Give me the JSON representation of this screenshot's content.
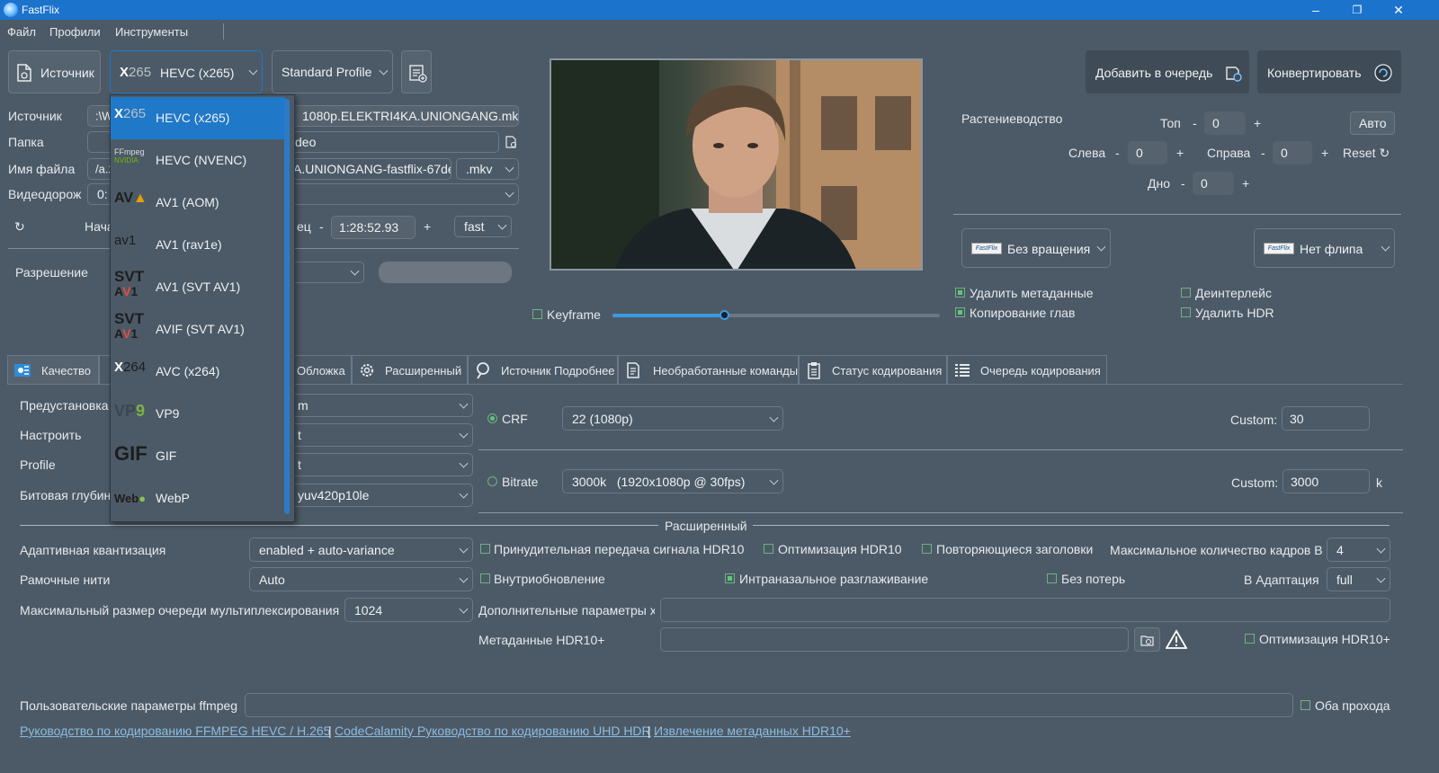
{
  "window": {
    "title": "FastFlix"
  },
  "menu": [
    "Файл",
    "Профили",
    "Инструменты"
  ],
  "toolbar": {
    "source_button": "Источник",
    "encoder_selected": "HEVC (x265)",
    "profile_selected": "Standard Profile",
    "add_queue": "Добавить в очередь",
    "convert": "Конвертировать"
  },
  "left": {
    "source_label": "Источник",
    "source_value": ":\\Wi",
    "source_value_tail": "1080p.ELEKTRI4KA.UNIONGANG.mkv",
    "folder_label": "Папка",
    "folder_tail": "deo",
    "filename_label": "Имя файла",
    "filename_value": "/a.2",
    "filename_tail": "A.UNIONGANG-fastflix-67de",
    "ext": ".mkv",
    "video_track_label": "Видеодорож",
    "video_track_value": "0:",
    "start_label": "Нача",
    "end_label_tail": "ец",
    "end_minus": "-",
    "end_time": "1:28:52.93",
    "end_plus": "+",
    "speed": "fast",
    "resolution_label": "Разрешение"
  },
  "encoder_dropdown": {
    "items": [
      {
        "logo": "x265",
        "label": "HEVC (x265)",
        "selected": true
      },
      {
        "logo": "FFmpeg NVIDIA",
        "label": "HEVC (NVENC)",
        "selected": false
      },
      {
        "logo": "AV1",
        "label": "AV1 (AOM)",
        "selected": false
      },
      {
        "logo": "av1",
        "label": "AV1 (rav1e)",
        "selected": false
      },
      {
        "logo": "SVT AV1",
        "label": "AV1 (SVT AV1)",
        "selected": false
      },
      {
        "logo": "SVT AV1",
        "label": "AVIF (SVT AV1)",
        "selected": false
      },
      {
        "logo": "x264",
        "label": "AVC (x264)",
        "selected": false
      },
      {
        "logo": "VP9",
        "label": "VP9",
        "selected": false
      },
      {
        "logo": "GIF",
        "label": "GIF",
        "selected": false
      },
      {
        "logo": "WebP",
        "label": "WebP",
        "selected": false
      }
    ]
  },
  "preview": {
    "keyframe_label": "Keyframe",
    "slider_value": 0.34
  },
  "crop": {
    "title": "Растениеводство",
    "top_label": "Топ",
    "left_label": "Слева",
    "right_label": "Справа",
    "bottom_label": "Дно",
    "top": "0",
    "left": "0",
    "right": "0",
    "bottom": "0",
    "minus": "-",
    "plus": "+",
    "auto": "Авто",
    "reset": "Reset"
  },
  "transform": {
    "rotation": "Без вращения",
    "flip": "Нет флипа",
    "thumb": "FastFlix"
  },
  "options": {
    "remove_metadata": "Удалить метаданные",
    "copy_chapters": "Копирование глав",
    "deinterlace": "Деинтерлейс",
    "remove_hdr": "Удалить HDR"
  },
  "tabs": [
    {
      "label": "Качество",
      "icon": "quality-icon"
    },
    {
      "label": "Обложка",
      "icon": "cover-icon"
    },
    {
      "label": "Расширенный",
      "icon": "gear-icon"
    },
    {
      "label": "Источник Подробнее",
      "icon": "info-icon"
    },
    {
      "label": "Необработанные команды",
      "icon": "document-icon"
    },
    {
      "label": "Статус кодирования",
      "icon": "clipboard-icon"
    },
    {
      "label": "Очередь кодирования",
      "icon": "list-icon"
    }
  ],
  "quality": {
    "preset_label": "Предустановка",
    "preset_value": "m",
    "tune_label": "Настроить",
    "tune_value": "t",
    "profile_label": "Profile",
    "profile_value": "t",
    "bitdepth_label": "Битовая глубин",
    "bitdepth_value": "yuv420p10le",
    "crf_label": "CRF",
    "crf_value": "22 (1080p)",
    "crf_custom_label": "Custom:",
    "crf_custom": "30",
    "bitrate_label": "Bitrate",
    "bitrate_value": "3000k   (1920x1080p @ 30fps)",
    "bitrate_custom_label": "Custom:",
    "bitrate_custom": "3000",
    "bitrate_unit": "k"
  },
  "advanced": {
    "section_title": "Расширенный",
    "aq_label": "Адаптивная квантизация",
    "aq_value": "enabled + auto-variance",
    "frame_threads_label": "Рамочные нити",
    "frame_threads_value": "Auto",
    "mux_queue_label": "Максимальный размер очереди мультиплексирования",
    "mux_queue_value": "1024",
    "hdr10_signal": "Принудительная передача сигнала HDR10",
    "hdr10_opt": "Оптимизация HDR10",
    "repeat_headers": "Повторяющиеся заголовки",
    "max_frames_label": "Максимальное количество кадров B",
    "max_frames_value": "4",
    "intra_refresh": "Внутриобновление",
    "intra_smoothing": "Интраназальное разглаживание",
    "lossless": "Без потерь",
    "b_adapt_label": "В Адаптация",
    "b_adapt_value": "full",
    "extra_params_label": "Дополнительные параметры x",
    "hdr10plus_label": "Метаданные HDR10+",
    "hdr10plus_opt": "Оптимизация HDR10+",
    "ffmpeg_params_label": "Пользовательские параметры ffmpeg",
    "both_passes": "Оба прохода"
  },
  "links": [
    "Руководство по кодированию FFMPEG HEVC / H.265",
    "CodeCalamity Руководство по кодированию UHD HDR",
    "Извлечение метаданных HDR10+"
  ],
  "separator": "|",
  "colors": {
    "titlebar": "#1b73cc",
    "background": "#4c5a67",
    "selection": "#1f78c8",
    "link": "#8cbbe0",
    "check": "#5ec779"
  }
}
